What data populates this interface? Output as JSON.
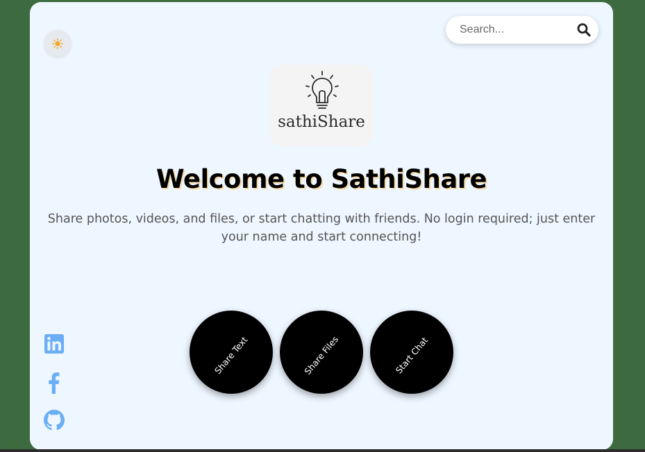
{
  "search": {
    "placeholder": "Search..."
  },
  "theme_toggle": {
    "icon": "sun-icon"
  },
  "logo": {
    "text": "sathiShare",
    "icon": "lightbulb-icon"
  },
  "hero": {
    "title": "Welcome to SathiShare",
    "subtitle": "Share photos, videos, and files, or start chatting with friends. No login required; just enter your name and start connecting!"
  },
  "actions": [
    {
      "label": "Share Text"
    },
    {
      "label": "Share Files"
    },
    {
      "label": "Start Chat"
    }
  ],
  "social": [
    {
      "icon": "linkedin-icon"
    },
    {
      "icon": "facebook-icon"
    },
    {
      "icon": "github-icon"
    }
  ],
  "colors": {
    "background": "#3d6b3f",
    "card": "#eef6ff",
    "accent_icon": "#6aaef5",
    "sun": "#f5a623",
    "button": "#000000"
  }
}
